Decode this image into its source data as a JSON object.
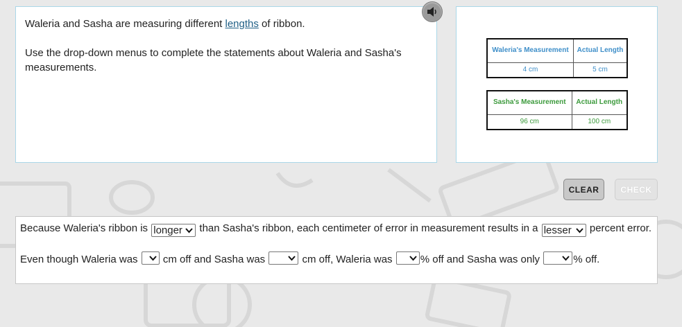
{
  "question": {
    "sentence1_before": "Waleria and Sasha are measuring different ",
    "sentence1_link": "lengths",
    "sentence1_after": " of ribbon.",
    "instruction": "Use the drop-down menus to complete the statements about Waleria and Sasha's measurements."
  },
  "figure": {
    "table1": {
      "header_left": "Waleria's Measurement",
      "header_right": "Actual Length",
      "value_left": "4 cm",
      "value_right": "5 cm"
    },
    "table2": {
      "header_left": "Sasha's Measurement",
      "header_right": "Actual Length",
      "value_left": "96 cm",
      "value_right": "100 cm"
    },
    "colors": {
      "table1_text": "#3f8fc9",
      "table2_text": "#3c9a3c"
    }
  },
  "buttons": {
    "clear": "CLEAR",
    "check": "CHECK"
  },
  "answers": {
    "line1": {
      "part1": "Because Waleria's ribbon is ",
      "dropdown1": "longer",
      "part2": " than Sasha's ribbon, each centimeter of error in measurement results in a ",
      "dropdown2": "lesser",
      "part3": " percent error."
    },
    "line2": {
      "part1": "Even though Waleria was ",
      "dropdown1": "",
      "part2": " cm off and Sasha was ",
      "dropdown2": "",
      "part3": " cm off, Waleria was ",
      "dropdown3": "",
      "part4": "% off and Sasha was only ",
      "dropdown4": "",
      "part5": "% off."
    }
  }
}
